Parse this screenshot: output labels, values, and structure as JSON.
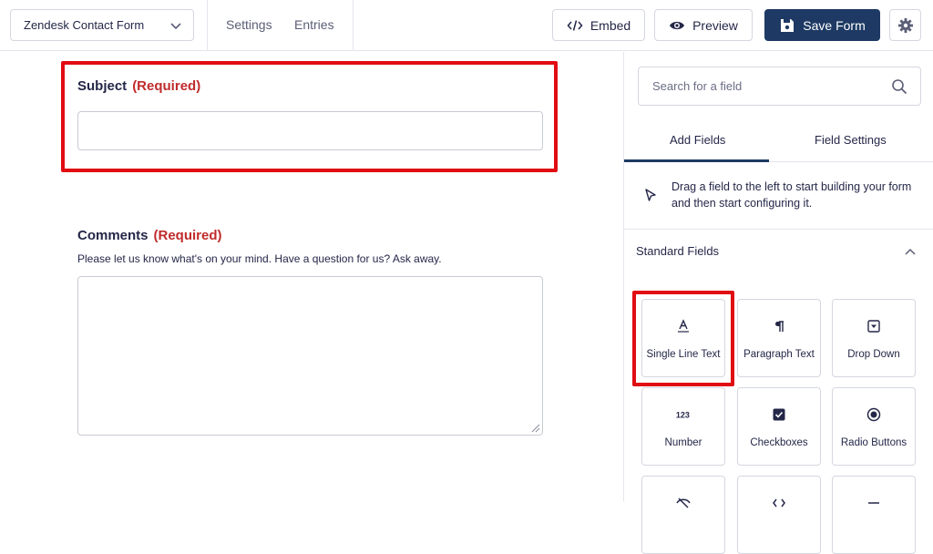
{
  "header": {
    "form_selector": "Zendesk Contact Form",
    "nav": [
      "Settings",
      "Entries"
    ],
    "embed_label": "Embed",
    "preview_label": "Preview",
    "save_label": "Save Form"
  },
  "form": {
    "subject": {
      "label": "Subject",
      "required": "(Required)"
    },
    "comments": {
      "label": "Comments",
      "required": "(Required)",
      "description": "Please let us know what's on your mind. Have a question for us? Ask away."
    }
  },
  "sidebar": {
    "search_placeholder": "Search for a field",
    "tabs": [
      "Add Fields",
      "Field Settings"
    ],
    "active_tab": "Add Fields",
    "hint": "Drag a field to the left to start building your form and then start configuring it.",
    "section_title": "Standard Fields",
    "fields": [
      {
        "label": "Single Line Text",
        "icon": "single-line-text-icon"
      },
      {
        "label": "Paragraph Text",
        "icon": "paragraph-icon"
      },
      {
        "label": "Drop Down",
        "icon": "dropdown-icon"
      },
      {
        "label": "Number",
        "icon": "number-icon"
      },
      {
        "label": "Checkboxes",
        "icon": "checkbox-icon"
      },
      {
        "label": "Radio Buttons",
        "icon": "radio-icon"
      }
    ]
  },
  "colors": {
    "primary": "#1e3a64",
    "required": "#c02b2b",
    "highlight": "#e00d12"
  }
}
